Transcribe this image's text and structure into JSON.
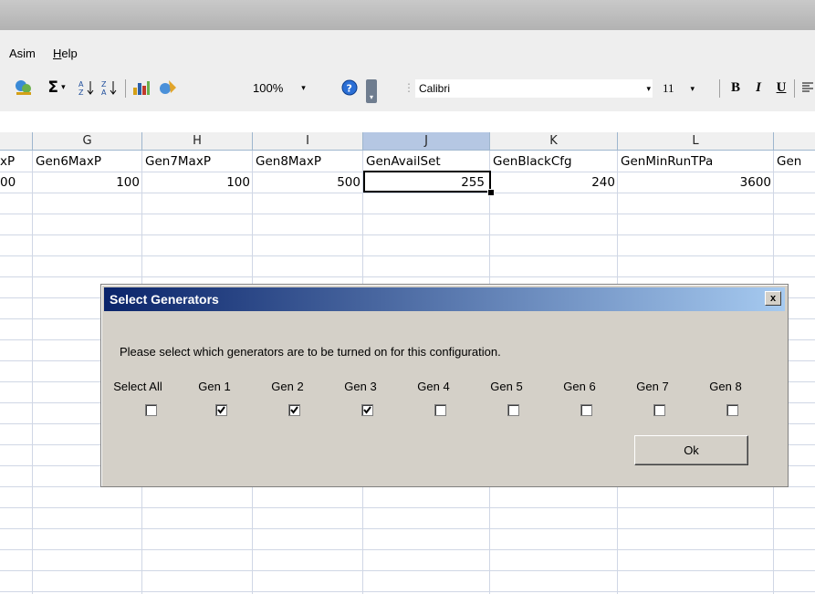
{
  "menu": {
    "items": [
      {
        "label": "Asim"
      },
      {
        "label": "Help"
      }
    ]
  },
  "toolbar": {
    "zoom": "100%",
    "font_name": "Calibri",
    "font_size": "11",
    "bold_label": "B",
    "italic_label": "I",
    "underline_label": "U",
    "sum_label": "Σ"
  },
  "sheet": {
    "columns": [
      "G",
      "H",
      "I",
      "J",
      "K",
      "L"
    ],
    "headers": {
      "partial_left": "xP",
      "G": "Gen6MaxP",
      "H": "Gen7MaxP",
      "I": "Gen8MaxP",
      "J": "GenAvailSet",
      "K": "GenBlackCfg",
      "L": "GenMinRunTPa",
      "partial_right": "Gen"
    },
    "values": {
      "partial_left": "00",
      "G": "100",
      "H": "100",
      "I": "500",
      "J": "255",
      "K": "240",
      "L": "3600"
    },
    "selected_column": "J"
  },
  "dialog": {
    "title": "Select Generators",
    "close_label": "x",
    "message": "Please select which generators are to be turned on for this configuration.",
    "options": [
      {
        "label": "Select All",
        "checked": false
      },
      {
        "label": "Gen 1",
        "checked": true
      },
      {
        "label": "Gen 2",
        "checked": true
      },
      {
        "label": "Gen 3",
        "checked": true
      },
      {
        "label": "Gen 4",
        "checked": false
      },
      {
        "label": "Gen 5",
        "checked": false
      },
      {
        "label": "Gen 6",
        "checked": false
      },
      {
        "label": "Gen 7",
        "checked": false
      },
      {
        "label": "Gen 8",
        "checked": false
      }
    ],
    "ok_label": "Ok"
  }
}
